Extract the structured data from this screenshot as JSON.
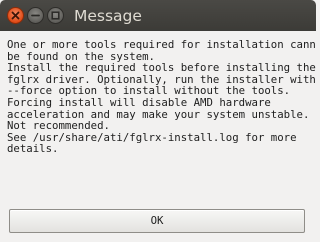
{
  "window": {
    "title": "Message",
    "controls": {
      "close_icon": "close-icon",
      "minimize_icon": "minimize-icon",
      "maximize_icon": "maximize-icon"
    }
  },
  "message": {
    "lines": [
      "One or more tools required for installation cannot",
      "be found on the system.",
      "Install the required tools before installing the",
      "fglrx driver. Optionally, run the installer with",
      "--force option to install without the tools.",
      "Forcing install will disable AMD hardware",
      "acceleration and may make your system unstable.",
      "Not recommended.",
      "See /usr/share/ati/fglrx-install.log for more",
      "details."
    ]
  },
  "buttons": {
    "ok_label": "OK"
  },
  "colors": {
    "titlebar": "#3c3b37",
    "close_button": "#df4a16",
    "background": "#f2f1f0"
  }
}
